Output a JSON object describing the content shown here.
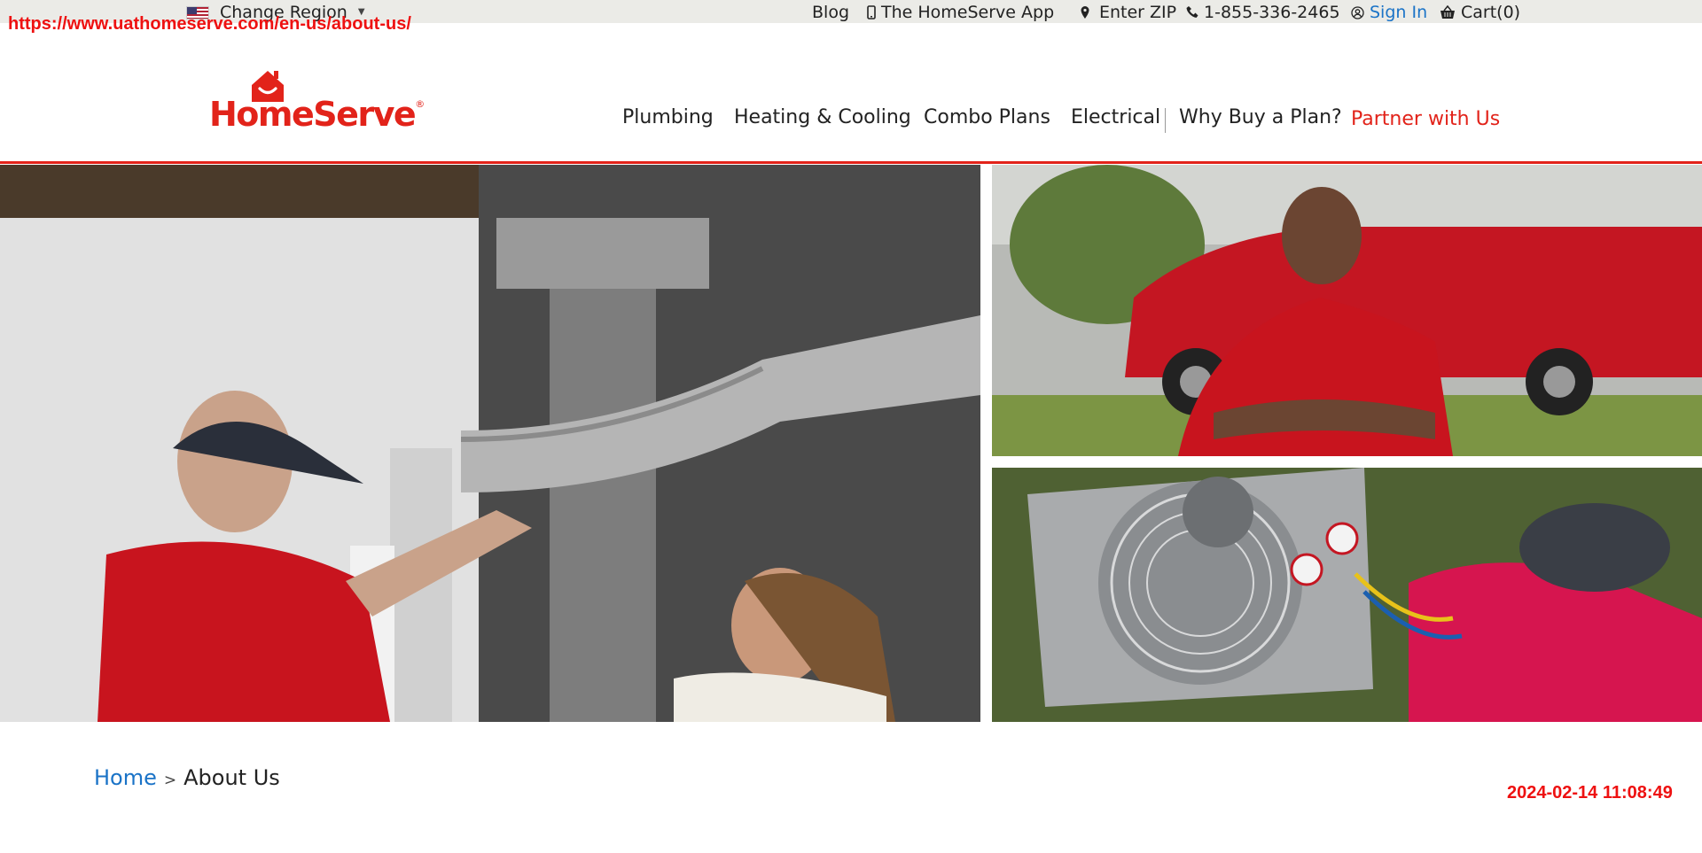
{
  "browser_overlay": {
    "url": "https://www.uathomeserve.com/en-us/about-us/",
    "timestamp": "2024-02-14 11:08:49"
  },
  "topbar": {
    "region": "Change Region",
    "blog": "Blog",
    "app": "The HomeServe App",
    "zip": "Enter ZIP",
    "phone": "1-855-336-2465",
    "sign_in": "Sign In",
    "cart": "Cart(0)"
  },
  "logo": {
    "text": "HomeServe",
    "mark": "®"
  },
  "nav": {
    "plumbing": "Plumbing",
    "heating": "Heating & Cooling",
    "combo": "Combo Plans",
    "electrical": "Electrical",
    "why": "Why Buy a Plan?",
    "partner": "Partner with Us"
  },
  "breadcrumb": {
    "home": "Home",
    "separator": ">",
    "current": "About Us"
  },
  "colors": {
    "brand_red": "#e2231a",
    "link_blue": "#1a73c7",
    "topbar_bg": "#ebebe7"
  },
  "icons": [
    "us-flag-icon",
    "phone-device-icon",
    "location-pin-icon",
    "phone-handset-icon",
    "user-circle-icon",
    "basket-icon",
    "home-logo-icon"
  ]
}
